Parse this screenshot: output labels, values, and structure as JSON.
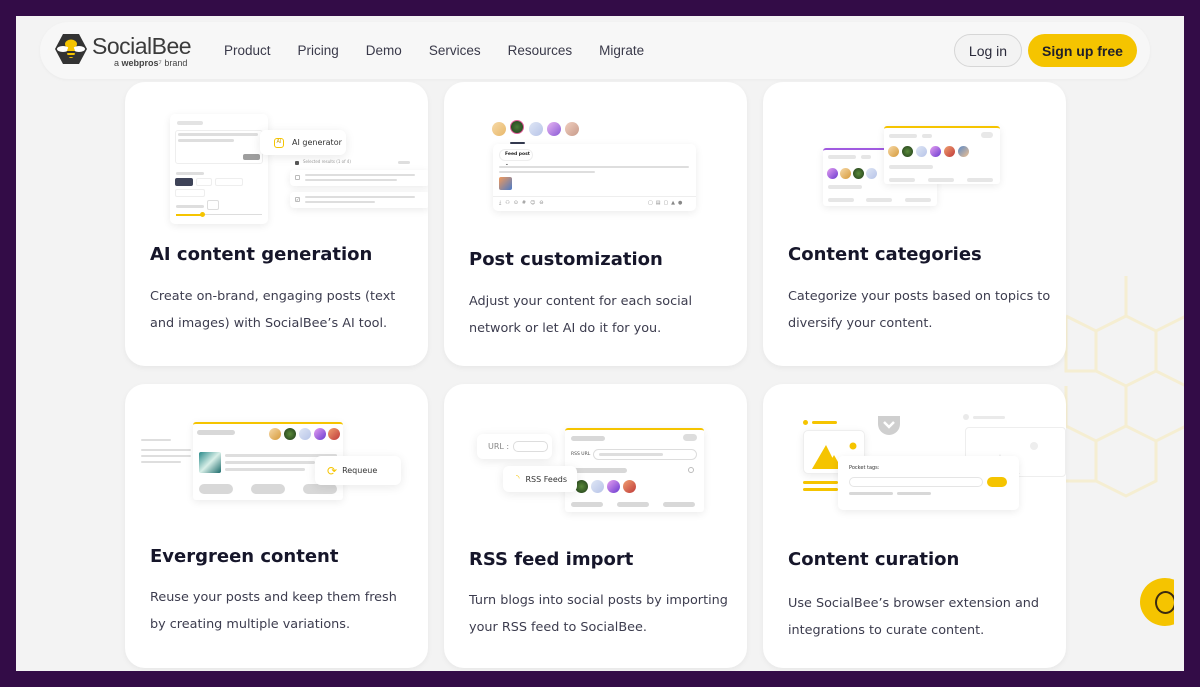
{
  "brand": {
    "name": "SocialBee",
    "tagline_prefix": "a",
    "tagline_brand": "webpros",
    "tagline_suffix": "brand",
    "accent_color": "#f5c400",
    "frame_color": "#330c47"
  },
  "nav": {
    "links": [
      "Product",
      "Pricing",
      "Demo",
      "Services",
      "Resources",
      "Migrate"
    ],
    "login_label": "Log in",
    "signup_label": "Sign up free"
  },
  "features": [
    {
      "title": "AI content generation",
      "description": "Create on-brand, engaging posts (text and images) with SocialBee’s AI tool.",
      "illustration": {
        "badge_label": "AI generator",
        "results_label": "Selected results (1 of 4)"
      }
    },
    {
      "title": "Post customization",
      "description": "Adjust your content for each social network or let AI do it for you.",
      "illustration": {
        "dropdown_label": "Feed post"
      }
    },
    {
      "title": "Content categories",
      "description": "Categorize your posts based on topics to diversify your content.",
      "illustration": {}
    },
    {
      "title": "Evergreen content",
      "description": "Reuse your posts and keep them fresh by creating multiple variations.",
      "illustration": {
        "badge_label": "Requeue"
      }
    },
    {
      "title": "RSS feed import",
      "description": "Turn blogs into social posts by importing your RSS feed to SocialBee.",
      "illustration": {
        "url_label": "URL :",
        "badge_label": "RSS Feeds",
        "field_label": "RSS URL"
      }
    },
    {
      "title": "Content curation",
      "description": "Use SocialBee’s browser extension and integrations to curate content.",
      "illustration": {
        "field_label": "Pocket tags:"
      }
    }
  ],
  "chat_widget": {
    "icon": "chat-bubble-icon"
  }
}
